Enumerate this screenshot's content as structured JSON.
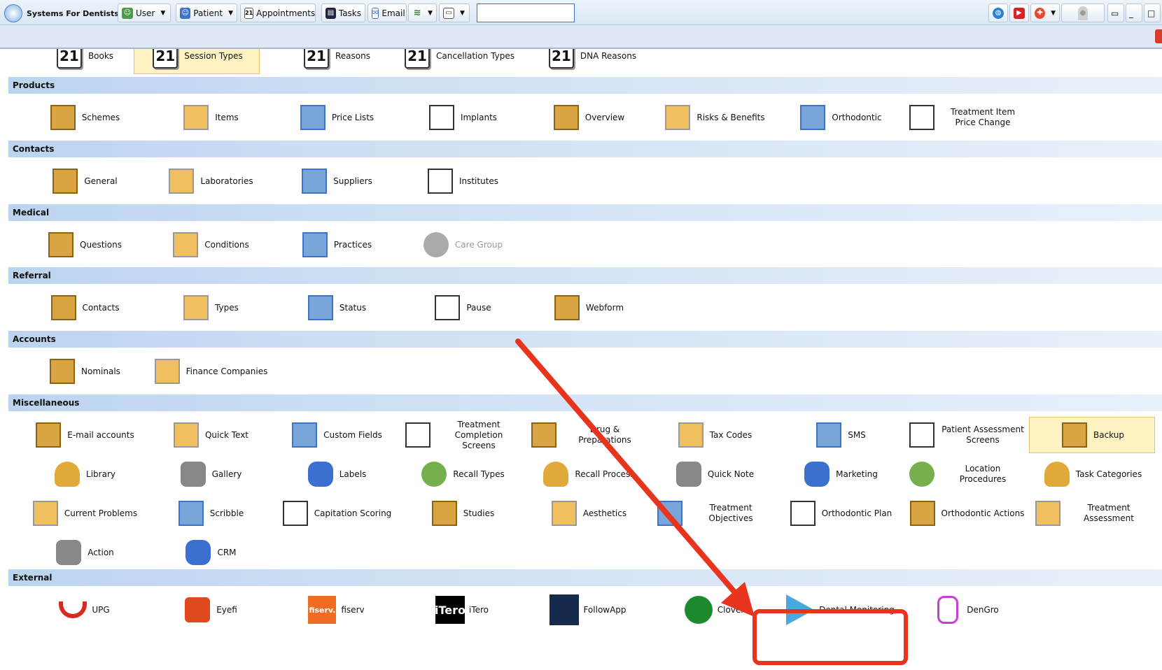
{
  "app": {
    "title": "Systems For Dentists"
  },
  "toolbar": {
    "user": "User",
    "patient": "Patient",
    "appointments": "Appointments",
    "tasks": "Tasks",
    "email": "Email",
    "search_value": ""
  },
  "top_row": [
    {
      "label": "Books",
      "day": "21"
    },
    {
      "label": "Session Types",
      "day": "21",
      "selected": true
    },
    {
      "label": "Reasons",
      "day": "21"
    },
    {
      "label": "Cancellation Types",
      "day": "21"
    },
    {
      "label": "DNA Reasons",
      "day": "21"
    }
  ],
  "sections": {
    "products": {
      "title": "Products",
      "items": [
        "Schemes",
        "Items",
        "Price Lists",
        "Implants",
        "Overview",
        "Risks & Benefits",
        "Orthodontic",
        "Treatment Item Price Change"
      ]
    },
    "contacts": {
      "title": "Contacts",
      "items": [
        "General",
        "Laboratories",
        "Suppliers",
        "Institutes"
      ]
    },
    "medical": {
      "title": "Medical",
      "items": [
        "Questions",
        "Conditions",
        "Practices",
        "Care Group"
      ]
    },
    "referral": {
      "title": "Referral",
      "items": [
        "Contacts",
        "Types",
        "Status",
        "Pause",
        "Webform"
      ]
    },
    "accounts": {
      "title": "Accounts",
      "items": [
        "Nominals",
        "Finance Companies"
      ]
    },
    "misc": {
      "title": "Miscellaneous",
      "items": [
        "E-mail accounts",
        "Quick Text",
        "Custom Fields",
        "Treatment Completion Screens",
        "Drug & Preparations",
        "Tax Codes",
        "SMS",
        "Patient Assessment Screens",
        "Backup",
        "Library",
        "Gallery",
        "Labels",
        "Recall Types",
        "Recall Process",
        "Quick Note",
        "Marketing",
        "Location Procedures",
        "Task Categories",
        "Current Problems",
        "Scribble",
        "Capitation Scoring",
        "Studies",
        "Aesthetics",
        "Treatment Objectives",
        "Orthodontic Plan",
        "Orthodontic Actions",
        "Treatment Assessment",
        "Action",
        "CRM"
      ]
    },
    "external": {
      "title": "External",
      "items": [
        "UPG",
        "Eyefi",
        "fiserv",
        "iTero",
        "FollowApp",
        "Clover",
        "Dental Monitoring",
        "DenGro"
      ]
    }
  },
  "logos": {
    "fiserv": "fiserv.",
    "itero": "iTero"
  },
  "colors": {
    "accent": "#e8331d",
    "header_bg": "#cddff4",
    "selected_bg": "#fff3c4"
  },
  "icons": {
    "schemes": "crate-icon",
    "items": "scales-icon",
    "price-lists": "price-list-icon",
    "implants": "implant-icon",
    "overview": "overview-icon",
    "risks": "warning-icon",
    "orthodontic": "braces-icon"
  }
}
